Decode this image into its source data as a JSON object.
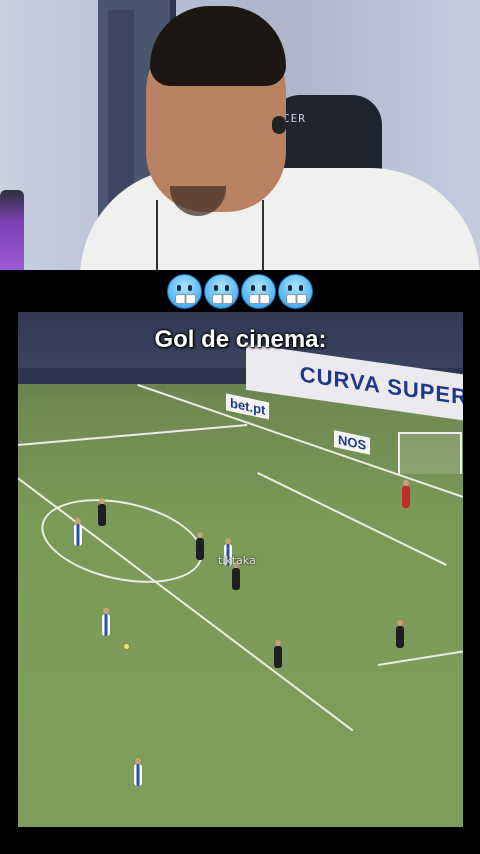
{
  "reaction": {
    "emoji": [
      "cold-face-emoji",
      "cold-face-emoji",
      "cold-face-emoji",
      "cold-face-emoji"
    ]
  },
  "video": {
    "caption": "Gol de cinema:",
    "watermark": "tiktaka",
    "boards": {
      "curva": "CURVA SUPER",
      "bet": "bet.pt",
      "nos": "NOS"
    }
  },
  "webcam": {
    "chair_logo": "CER"
  }
}
